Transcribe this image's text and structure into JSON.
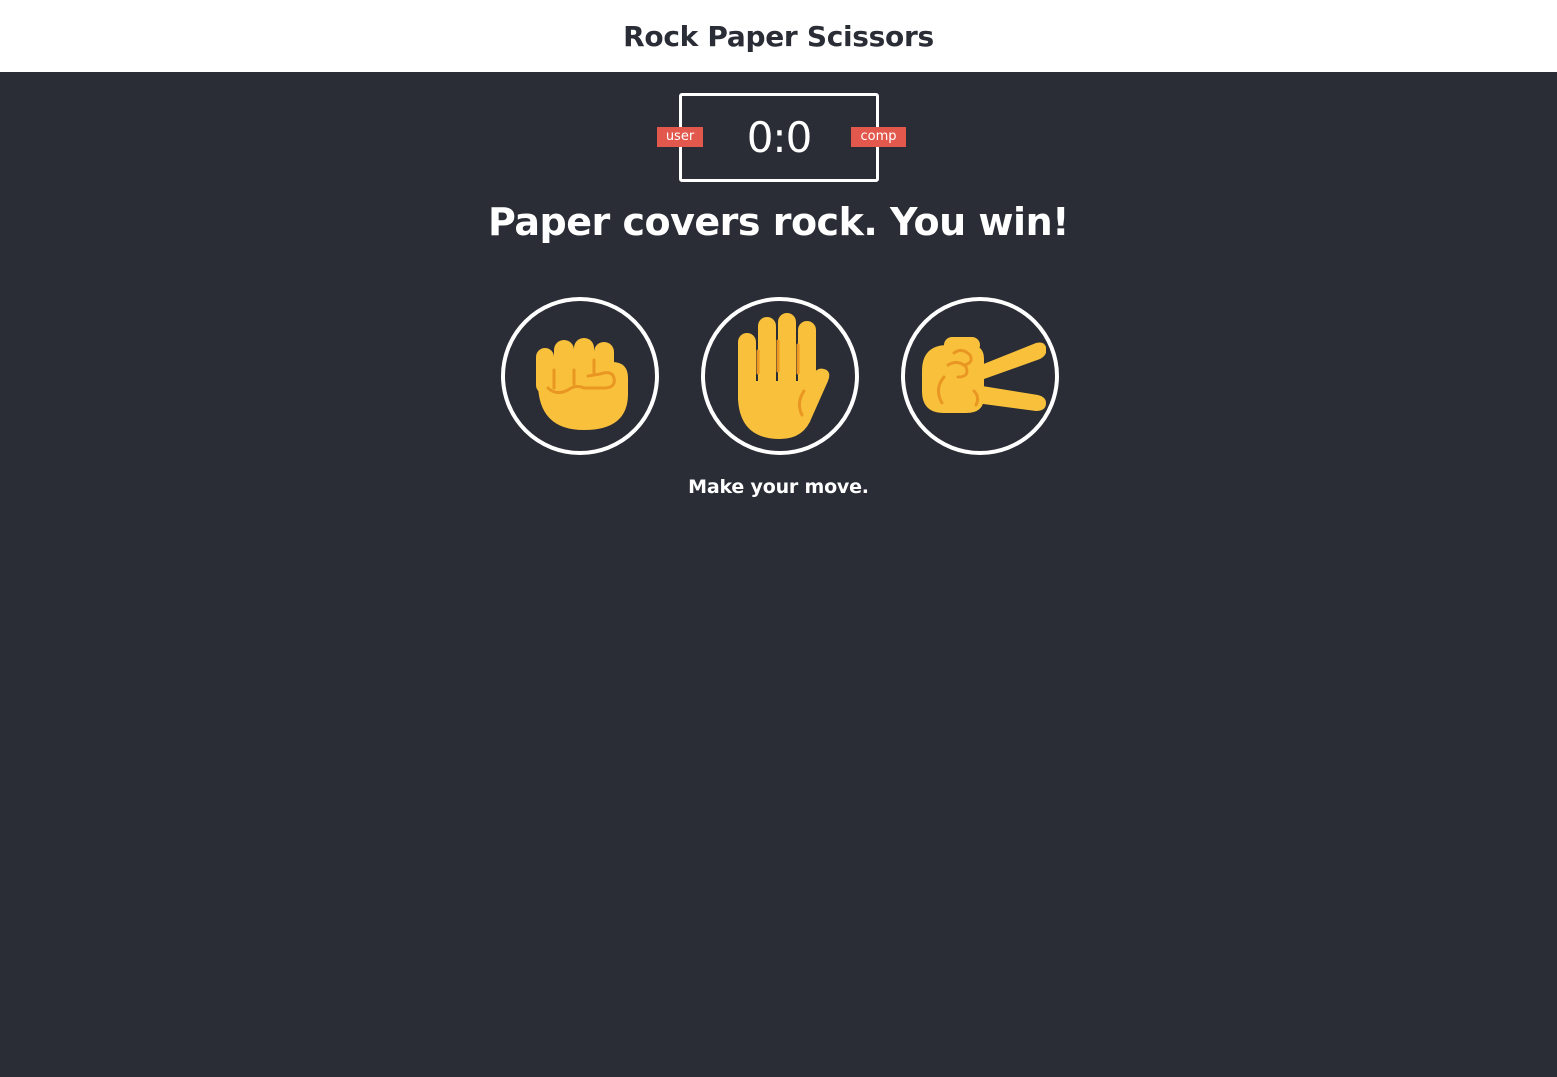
{
  "header": {
    "title": "Rock Paper Scissors"
  },
  "scoreboard": {
    "user_label": "user",
    "comp_label": "comp",
    "score": "0:0"
  },
  "result": {
    "message": "Paper covers rock. You win!"
  },
  "choices": [
    {
      "name": "rock",
      "icon": "raised-fist-icon"
    },
    {
      "name": "paper",
      "icon": "raised-hand-icon"
    },
    {
      "name": "scissors",
      "icon": "victory-hand-icon"
    }
  ],
  "prompt": {
    "text": "Make your move."
  },
  "colors": {
    "background": "#2a2d36",
    "header_background": "#ffffff",
    "badge": "#e2584d",
    "hand_fill": "#f9c13b",
    "hand_line": "#e99722",
    "outline": "#ffffff"
  }
}
